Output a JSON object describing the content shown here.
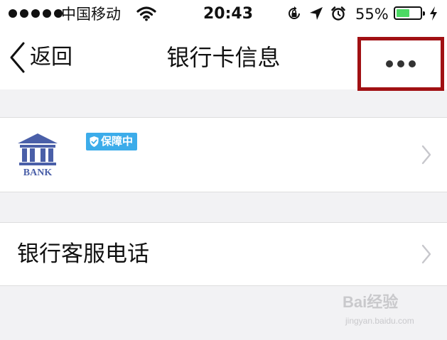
{
  "status_bar": {
    "carrier": "中国移动",
    "time": "20:43",
    "battery_percent": "55%",
    "battery_level": 0.55,
    "battery_color": "#4cd964",
    "icons": [
      "signal-dots",
      "wifi-icon",
      "orientation-lock-icon",
      "location-arrow-icon",
      "alarm-icon",
      "battery-icon",
      "charging-icon"
    ]
  },
  "nav": {
    "back_label": "返回",
    "title": "银行卡信息",
    "more_icon": "more-dots-icon",
    "highlight_color": "#a11013"
  },
  "card": {
    "logo_text": "BANK",
    "logo_color": "#4a5fa8",
    "badge": "保障中",
    "badge_color": "#3cacea"
  },
  "service": {
    "label": "银行客服电话"
  },
  "watermark": {
    "text": "Bai经验",
    "sub": "jingyan.baidu.com"
  }
}
